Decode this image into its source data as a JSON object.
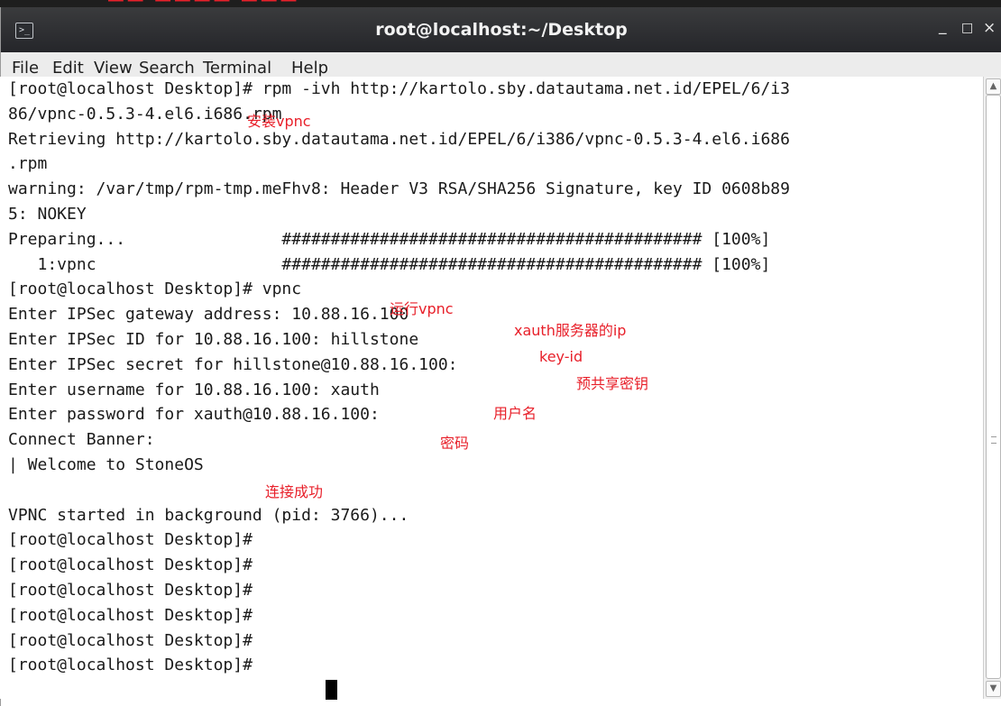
{
  "window": {
    "title": "root@localhost:~/Desktop",
    "app_icon": "terminal-icon",
    "controls": {
      "minimize": "_",
      "maximize": "□",
      "close": "×"
    }
  },
  "menu": [
    "File",
    "Edit",
    "View",
    "Search",
    "Terminal",
    "Help"
  ],
  "terminal": {
    "lines": [
      "[root@localhost Desktop]# rpm -ivh http://kartolo.sby.datautama.net.id/EPEL/6/i3",
      "86/vpnc-0.5.3-4.el6.i686.rpm",
      "Retrieving http://kartolo.sby.datautama.net.id/EPEL/6/i386/vpnc-0.5.3-4.el6.i686",
      ".rpm",
      "warning: /var/tmp/rpm-tmp.meFhv8: Header V3 RSA/SHA256 Signature, key ID 0608b89",
      "5: NOKEY",
      "Preparing...                ########################################### [100%]",
      "   1:vpnc                   ########################################### [100%]",
      "[root@localhost Desktop]# vpnc",
      "Enter IPSec gateway address: 10.88.16.100",
      "Enter IPSec ID for 10.88.16.100: hillstone",
      "Enter IPSec secret for hillstone@10.88.16.100:",
      "Enter username for 10.88.16.100: xauth",
      "Enter password for xauth@10.88.16.100:",
      "Connect Banner:",
      "| Welcome to StoneOS",
      "",
      "VPNC started in background (pid: 3766)...",
      "[root@localhost Desktop]#",
      "[root@localhost Desktop]#",
      "[root@localhost Desktop]#",
      "[root@localhost Desktop]#",
      "[root@localhost Desktop]#",
      "[root@localhost Desktop]#"
    ]
  },
  "annotations": {
    "install": "安装vpnc",
    "run": "运行vpnc",
    "server_ip": "xauth服务器的ip",
    "key_id": "key-id",
    "psk": "预共享密钥",
    "username": "用户名",
    "password": "密码",
    "success": "连接成功"
  },
  "colors": {
    "annotation": "#e8202a",
    "titlebar": "#2f3034",
    "terminal_bg": "#ffffff",
    "terminal_fg": "#1a1a1a"
  }
}
